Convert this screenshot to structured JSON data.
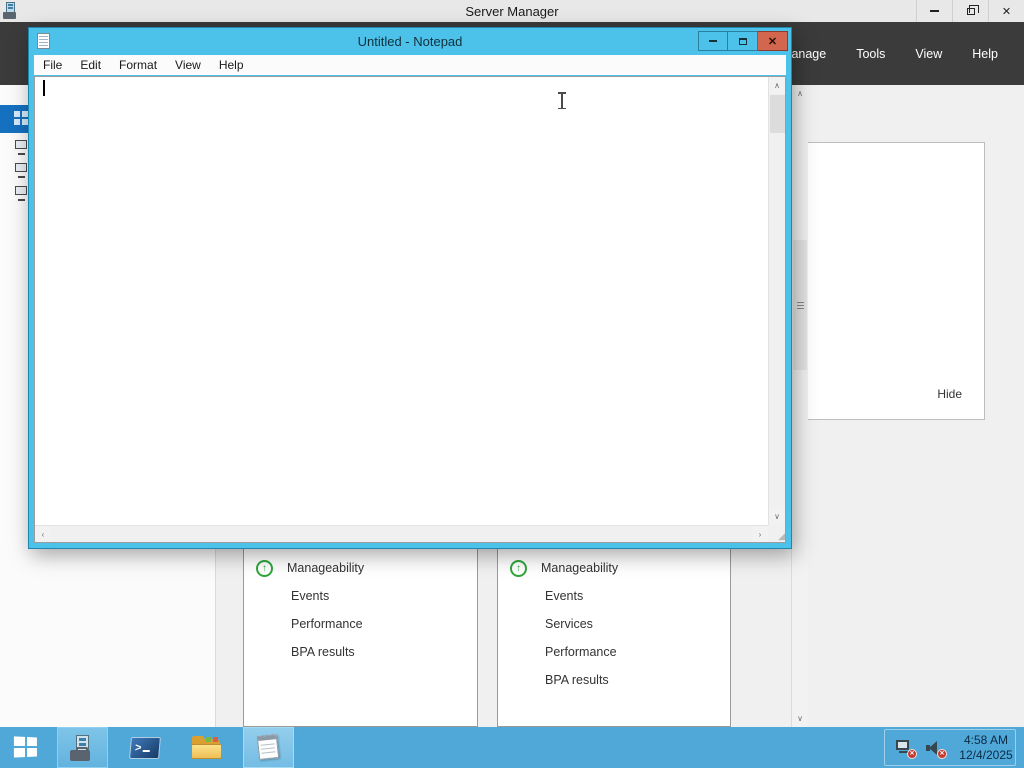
{
  "server_manager": {
    "title": "Server Manager",
    "menu": [
      "Manage",
      "Tools",
      "View",
      "Help"
    ],
    "hide_label": "Hide",
    "tiles": [
      {
        "items": [
          "Manageability",
          "Events",
          "Performance",
          "BPA results"
        ]
      },
      {
        "items": [
          "Manageability",
          "Events",
          "Services",
          "Performance",
          "BPA results"
        ]
      }
    ]
  },
  "notepad": {
    "title": "Untitled - Notepad",
    "menu": [
      "File",
      "Edit",
      "Format",
      "View",
      "Help"
    ],
    "text": ""
  },
  "taskbar": {
    "clock_time": "4:58 AM",
    "clock_date": "12/4/2025"
  },
  "icons": {
    "close_glyph": "✕",
    "scroll_up": "∧",
    "scroll_down": "∨",
    "scroll_left": "‹",
    "scroll_right": "›",
    "resize_grip": "◢",
    "tile_status_arrow": "↑"
  },
  "colors": {
    "taskbar_blue": "#4FA8D8",
    "notepad_chrome_cyan": "#4CC1E9",
    "close_button_red": "#D2664E",
    "navbar_dark": "#3B3B3B",
    "sidebar_selected_blue": "#1570C0",
    "tile_status_green": "#2EA73C"
  }
}
